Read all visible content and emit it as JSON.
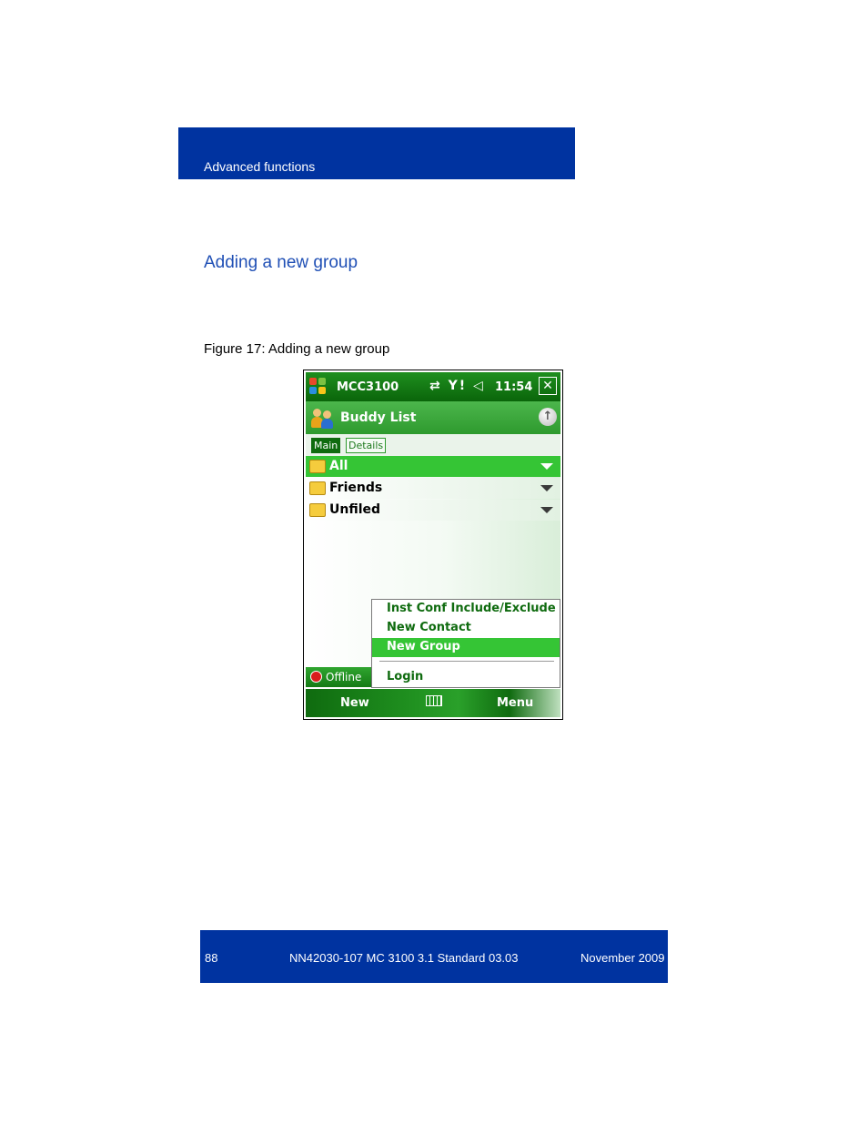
{
  "header": {
    "section_label": "Advanced functions"
  },
  "section_title": "Adding a new group",
  "figure_caption": "Figure 17: Adding a new group",
  "screen": {
    "titlebar": {
      "app_name": "MCC3100",
      "status_icons": "⇄ Y! ◁",
      "time": "11:54",
      "close_label": "✕"
    },
    "appbar": {
      "title": "Buddy List",
      "icon": "buddy-icon",
      "up_label": "↑"
    },
    "tabs": [
      {
        "label": "Main",
        "selected": true
      },
      {
        "label": "Details",
        "selected": false
      }
    ],
    "groups": [
      {
        "label": "All",
        "selected": true
      },
      {
        "label": "Friends",
        "selected": false
      },
      {
        "label": "Unfiled",
        "selected": false
      }
    ],
    "status": {
      "label": "Offline"
    },
    "context_menu": [
      {
        "label": "Inst Conf Include/Exclude",
        "selected": false
      },
      {
        "label": "New Contact",
        "selected": false
      },
      {
        "label": "New Group",
        "selected": true
      },
      {
        "label": "Login",
        "selected": false
      }
    ],
    "softkeys": {
      "left": "New",
      "right": "Menu",
      "keyboard_icon": "keyboard-icon"
    },
    "colors": {
      "accent_green": "#35c535",
      "dark_green": "#0f6b0f"
    }
  },
  "footer": {
    "page_number": "88",
    "doc_id": "NN42030-107 MC 3100  3.1 Standard 03.03",
    "date": "November 2009"
  },
  "colors": {
    "brand_blue": "#0033a0",
    "title_blue": "#1f4fb5"
  }
}
